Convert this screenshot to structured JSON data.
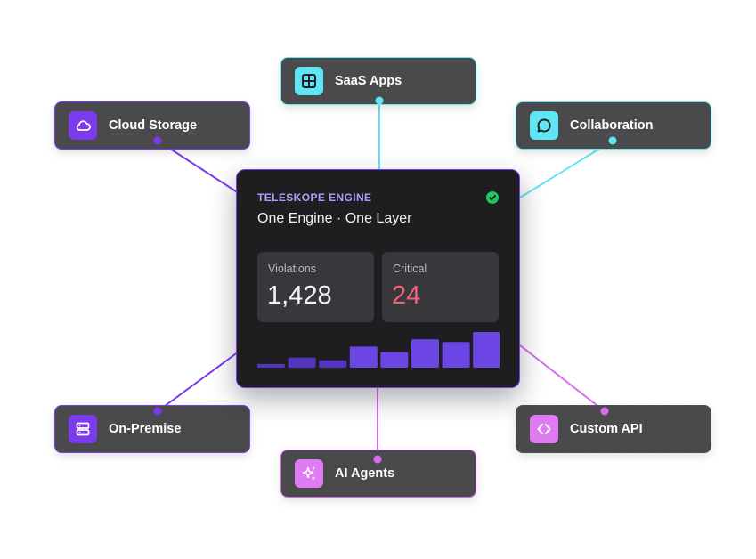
{
  "engine": {
    "eyebrow": "TELESKOPE ENGINE",
    "subtitle": "One Engine · One Layer",
    "status_icon": "check-circle-icon",
    "stats": [
      {
        "label": "Violations",
        "value": "1,428",
        "color": "#f4f4f4"
      },
      {
        "label": "Critical",
        "value": "24",
        "color": "#f0657a"
      }
    ]
  },
  "nodes": [
    {
      "id": "saas-apps",
      "label": "SaaS Apps",
      "icon": "grid-icon",
      "accent": "cyan"
    },
    {
      "id": "cloud-storage",
      "label": "Cloud Storage",
      "icon": "cloud-icon",
      "accent": "purple"
    },
    {
      "id": "collaboration",
      "label": "Collaboration",
      "icon": "chat-bubble-icon",
      "accent": "cyan"
    },
    {
      "id": "on-premise",
      "label": "On-Premise",
      "icon": "server-icon",
      "accent": "purple"
    },
    {
      "id": "ai-agents",
      "label": "AI Agents",
      "icon": "sparkle-icon",
      "accent": "pink"
    },
    {
      "id": "custom-api",
      "label": "Custom API",
      "icon": "code-brackets-icon",
      "accent": "pink"
    }
  ],
  "colors": {
    "purple": "#7c3aed",
    "cyan": "#5ee6f5",
    "pink": "#d66df0",
    "bar": "#6b46e5",
    "bar_faint": "#5535c0"
  },
  "chart_data": {
    "type": "bar",
    "values": [
      4,
      11,
      8,
      23,
      17,
      31,
      28,
      39
    ]
  }
}
